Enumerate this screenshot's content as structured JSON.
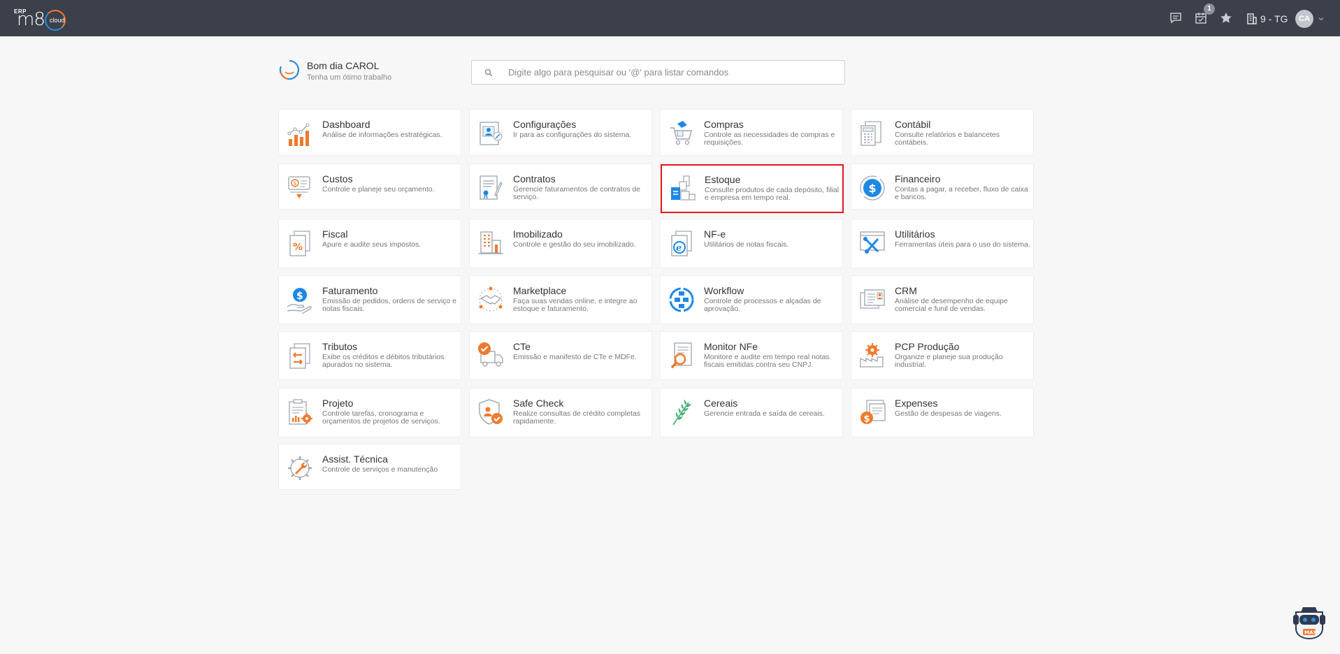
{
  "header": {
    "logo": {
      "erp": "ERP",
      "brand": "m8",
      "cloud": "cloud"
    },
    "notification_count": "1",
    "company": "9 - TG",
    "avatar_initials": "CA",
    "icons": [
      "chat-icon",
      "calendar-check-icon",
      "star-icon",
      "building-icon",
      "chevron-down-icon"
    ]
  },
  "greeting": {
    "title": "Bom dia CAROL",
    "subtitle": "Tenha um ótimo trabalho"
  },
  "search": {
    "placeholder": "Digite algo para pesquisar ou '@' para listar comandos"
  },
  "colors": {
    "accent_blue": "#1e88e5",
    "accent_orange": "#f07a2d",
    "topbar": "#3b404a",
    "selection": "#e0161e"
  },
  "modules": [
    {
      "title": "Dashboard",
      "desc": "Análise de informações estratégicas.",
      "icon": "bar-chart-icon"
    },
    {
      "title": "Configurações",
      "desc": "Ir para as configurações do sistema.",
      "icon": "settings-user-icon"
    },
    {
      "title": "Compras",
      "desc": "Controle as necessidades de compras e requisições.",
      "icon": "shopping-cart-icon"
    },
    {
      "title": "Contábil",
      "desc": "Consulte relatórios e balancetes contábeis.",
      "icon": "calculator-icon"
    },
    {
      "title": "Custos",
      "desc": "Controle e planeje seu orçamento.",
      "icon": "money-bill-icon"
    },
    {
      "title": "Contratos",
      "desc": "Gerencie faturamentos de contratos de serviço.",
      "icon": "contract-icon"
    },
    {
      "title": "Estoque",
      "desc": "Consulte produtos de cada depósito, filial e empresa em tempo real.",
      "icon": "boxes-icon"
    },
    {
      "title": "Financeiro",
      "desc": "Contas a pagar, a receber, fluxo de caixa e bancos.",
      "icon": "dollar-coin-icon"
    },
    {
      "title": "Fiscal",
      "desc": "Apure e audite seus impostos.",
      "icon": "percent-document-icon"
    },
    {
      "title": "Imobilizado",
      "desc": "Controle e gestão do seu imobilizado.",
      "icon": "building-icon"
    },
    {
      "title": "NF-e",
      "desc": "Utilitários de notas fiscais.",
      "icon": "e-document-icon"
    },
    {
      "title": "Utilitários",
      "desc": "Ferramentas úteis para o uso do sistema.",
      "icon": "tools-icon"
    },
    {
      "title": "Faturamento",
      "desc": "Emissão de pedidos, ordens de serviço e notas fiscais.",
      "icon": "hand-dollar-icon"
    },
    {
      "title": "Marketplace",
      "desc": "Faça suas vendas online, e integre ao estoque e faturamento.",
      "icon": "handshake-icon"
    },
    {
      "title": "Workflow",
      "desc": "Controle de processos e alçadas de aprovação.",
      "icon": "workflow-icon"
    },
    {
      "title": "CRM",
      "desc": "Análise de desempenho de equipe comercial e funil de vendas.",
      "icon": "crm-card-icon"
    },
    {
      "title": "Tributos",
      "desc": "Exibe os créditos e débitos tributários apurados no sistema.",
      "icon": "tax-exchange-icon"
    },
    {
      "title": "CTe",
      "desc": "Emissão e manifesto de CTe e MDFe.",
      "icon": "truck-check-icon"
    },
    {
      "title": "Monitor NFe",
      "desc": "Monitore e audite em tempo real notas fiscais emitidas contra seu CNPJ.",
      "icon": "magnifier-document-icon"
    },
    {
      "title": "PCP Produção",
      "desc": "Organize e planeje sua produção industrial.",
      "icon": "factory-gear-icon"
    },
    {
      "title": "Projeto",
      "desc": "Controle tarefas, cronograma e orçamentos de projetos de serviços.",
      "icon": "project-clipboard-icon"
    },
    {
      "title": "Safe Check",
      "desc": "Realize consultas de crédito completas rapidamente.",
      "icon": "shield-check-icon"
    },
    {
      "title": "Cereais",
      "desc": "Gerencie entrada e saída de cereais.",
      "icon": "wheat-icon"
    },
    {
      "title": "Expenses",
      "desc": "Gestão de despesas de viagens.",
      "icon": "expenses-icon"
    },
    {
      "title": "Assist. Técnica",
      "desc": "Controle de serviços e manutenção",
      "icon": "wrench-gear-icon"
    }
  ]
}
